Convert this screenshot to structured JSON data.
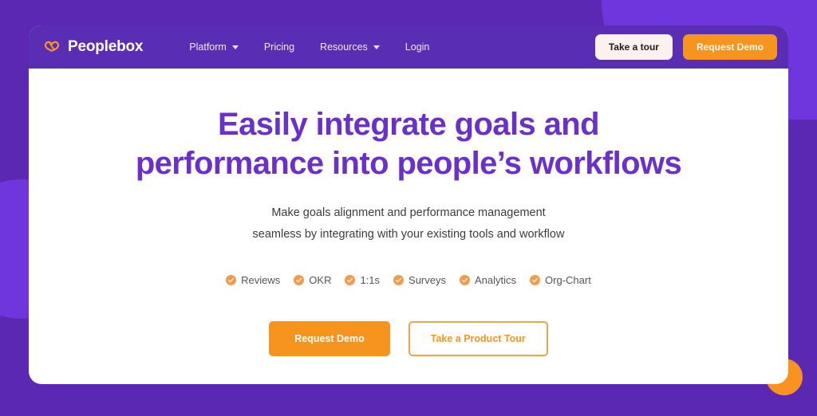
{
  "theme": {
    "background_purple": "#5A28B3",
    "blob_purple": "#6E36DC",
    "navbar_purple": "#5A2DB5",
    "accent_orange": "#F7941E",
    "heading_purple": "#6A30C8",
    "cream": "#FBF1EE",
    "card_white": "#FFFFFF"
  },
  "navbar": {
    "brand": {
      "icon": "peoplebox-logo-icon",
      "name": "Peoplebox"
    },
    "links": [
      {
        "label": "Platform",
        "has_dropdown": true
      },
      {
        "label": "Pricing",
        "has_dropdown": false
      },
      {
        "label": "Resources",
        "has_dropdown": true
      },
      {
        "label": "Login",
        "has_dropdown": false
      }
    ],
    "actions": {
      "tour_label": "Take a tour",
      "demo_label": "Request Demo"
    }
  },
  "hero": {
    "title_line1": "Easily integrate goals and",
    "title_line2": "performance into people’s workflows",
    "subtitle_line1": "Make goals alignment and performance management",
    "subtitle_line2": "seamless by integrating with your existing tools and workflow",
    "features": [
      {
        "icon": "check-circle-icon",
        "label": "Reviews"
      },
      {
        "icon": "check-circle-icon",
        "label": "OKR"
      },
      {
        "icon": "check-circle-icon",
        "label": "1:1s"
      },
      {
        "icon": "check-circle-icon",
        "label": "Surveys"
      },
      {
        "icon": "check-circle-icon",
        "label": "Analytics"
      },
      {
        "icon": "check-circle-icon",
        "label": "Org-Chart"
      }
    ],
    "cta": {
      "primary_label": "Request Demo",
      "secondary_label": "Take a Product Tour"
    }
  },
  "decorations": [
    {
      "name": "blob-top-right",
      "color": "#6E36DC"
    },
    {
      "name": "blob-left",
      "color": "#6E36DC"
    },
    {
      "name": "blob-orange-bottom-right",
      "color": "#F7931E"
    }
  ]
}
